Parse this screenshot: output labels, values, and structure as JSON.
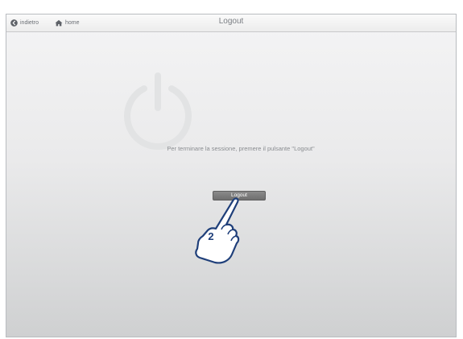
{
  "nav": {
    "back_label": "indietro",
    "home_label": "home"
  },
  "header": {
    "title": "Logout"
  },
  "main": {
    "message": "Per terminare la sessione, premere il pulsante \"Logout\"",
    "logout_button": "Logout"
  },
  "annotation": {
    "step_number": "2"
  },
  "colors": {
    "accent": "#1f3f7a",
    "button_bg": "#7a7a7a",
    "text_muted": "#8a8d91"
  },
  "icons": [
    "back-arrow-icon",
    "home-icon",
    "power-icon",
    "pointing-hand-icon"
  ]
}
